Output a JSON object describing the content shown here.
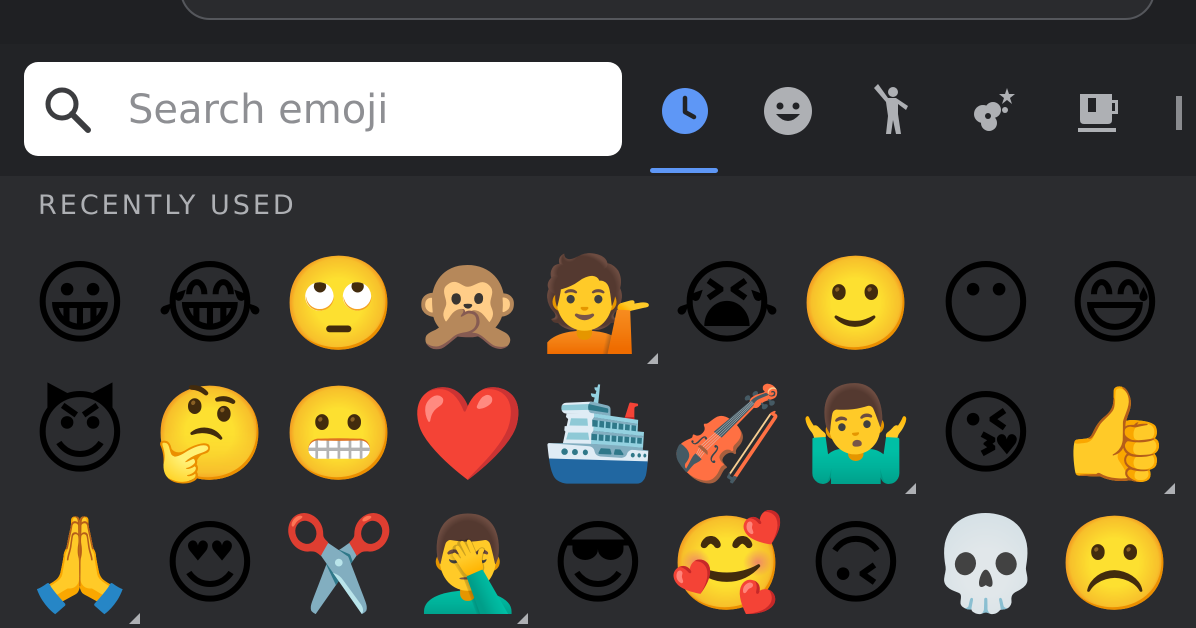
{
  "search": {
    "placeholder": "Search emoji"
  },
  "tabs": [
    {
      "name": "recent",
      "icon": "clock-icon",
      "active": true
    },
    {
      "name": "smileys",
      "icon": "smiley-icon",
      "active": false
    },
    {
      "name": "people",
      "icon": "person-icon",
      "active": false
    },
    {
      "name": "nature",
      "icon": "flower-icon",
      "active": false
    },
    {
      "name": "food",
      "icon": "coffee-icon",
      "active": false
    }
  ],
  "section": {
    "title": "RECENTLY USED"
  },
  "colors": {
    "accent": "#5e97f6",
    "background": "#2b2c2f",
    "header": "#222326",
    "label": "#aeb0b4"
  },
  "emojis": [
    [
      "😀",
      "😂",
      "🙄",
      "🙊",
      "💁",
      "😭",
      "🙂",
      "😶",
      "😅"
    ],
    [
      "😈",
      "🤔",
      "😬",
      "❤️",
      "🛳️",
      "🎻",
      "🤷‍♂️",
      "😘",
      "👍"
    ],
    [
      "🙏",
      "😍",
      "✂️",
      "🤦‍♂️",
      "😎",
      "🥰",
      "🙃",
      "💀",
      "☹️"
    ]
  ],
  "skin_variant_markers": [
    "0-4",
    "1-6",
    "1-8",
    "2-0",
    "2-3"
  ]
}
